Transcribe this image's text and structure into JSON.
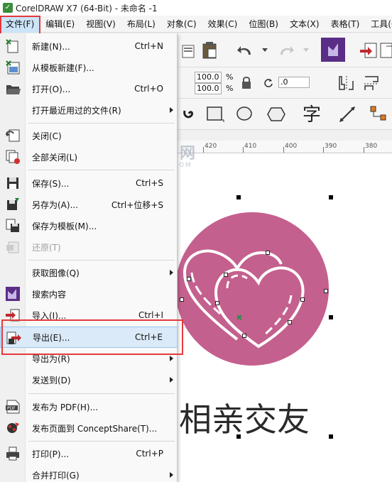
{
  "window": {
    "title": "CorelDRAW X7 (64-Bit) - 未命名 -1"
  },
  "menubar": {
    "items": [
      {
        "label": "文件(F)"
      },
      {
        "label": "编辑(E)"
      },
      {
        "label": "视图(V)"
      },
      {
        "label": "布局(L)"
      },
      {
        "label": "对象(C)"
      },
      {
        "label": "效果(C)"
      },
      {
        "label": "位图(B)"
      },
      {
        "label": "文本(X)"
      },
      {
        "label": "表格(T)"
      },
      {
        "label": "工具(O)"
      }
    ]
  },
  "toolbar": {
    "width_pct": "100.0",
    "height_pct": "100.0",
    "pct_symbol": "%",
    "rotation": ".0",
    "text_tool_glyph": "字"
  },
  "ruler": {
    "labels": [
      "420",
      "410",
      "400",
      "390",
      "380"
    ]
  },
  "watermark": {
    "big": "软件自学网",
    "small": "WWW.RJZXW.COM"
  },
  "file_menu": {
    "items": [
      {
        "label": "新建(N)...",
        "shortcut": "Ctrl+N",
        "icon": "new-doc-icon"
      },
      {
        "label": "从模板新建(F)...",
        "shortcut": "",
        "icon": "template-new-icon"
      },
      {
        "label": "打开(O)...",
        "shortcut": "Ctrl+O",
        "icon": "open-folder-icon"
      },
      {
        "label": "打开最近用过的文件(R)",
        "shortcut": "",
        "icon": "",
        "submenu": true
      },
      {
        "label": "关闭(C)",
        "shortcut": "",
        "icon": "close-doc-icon"
      },
      {
        "label": "全部关闭(L)",
        "shortcut": "",
        "icon": "close-all-icon"
      },
      {
        "label": "保存(S)...",
        "shortcut": "Ctrl+S",
        "icon": "save-icon"
      },
      {
        "label": "另存为(A)...",
        "shortcut": "Ctrl+位移+S",
        "icon": "save-as-icon"
      },
      {
        "label": "保存为模板(M)...",
        "shortcut": "",
        "icon": "save-template-icon"
      },
      {
        "label": "还原(T)",
        "shortcut": "",
        "icon": "revert-icon",
        "disabled": true
      },
      {
        "label": "获取图像(Q)",
        "shortcut": "",
        "icon": "",
        "submenu": true
      },
      {
        "label": "搜索内容",
        "shortcut": "",
        "icon": "search-content-icon"
      },
      {
        "label": "导入(I)...",
        "shortcut": "Ctrl+I",
        "icon": "import-icon"
      },
      {
        "label": "导出(E)...",
        "shortcut": "Ctrl+E",
        "icon": "export-icon"
      },
      {
        "label": "导出为(R)",
        "shortcut": "",
        "icon": "",
        "submenu": true
      },
      {
        "label": "发送到(D)",
        "shortcut": "",
        "icon": "",
        "submenu": true
      },
      {
        "label": "发布为 PDF(H)...",
        "shortcut": "",
        "icon": "pdf-icon"
      },
      {
        "label": "发布页面到 ConceptShare(T)...",
        "shortcut": "",
        "icon": "conceptshare-icon"
      },
      {
        "label": "打印(P)...",
        "shortcut": "Ctrl+P",
        "icon": "print-icon"
      },
      {
        "label": "合并打印(G)",
        "shortcut": "",
        "icon": "",
        "submenu": true
      }
    ]
  },
  "canvas": {
    "text": "相亲交友",
    "circle_color": "#c4608e"
  },
  "colors": {
    "highlight_red": "#e4393c",
    "menu_hover": "#dbeaf8"
  }
}
